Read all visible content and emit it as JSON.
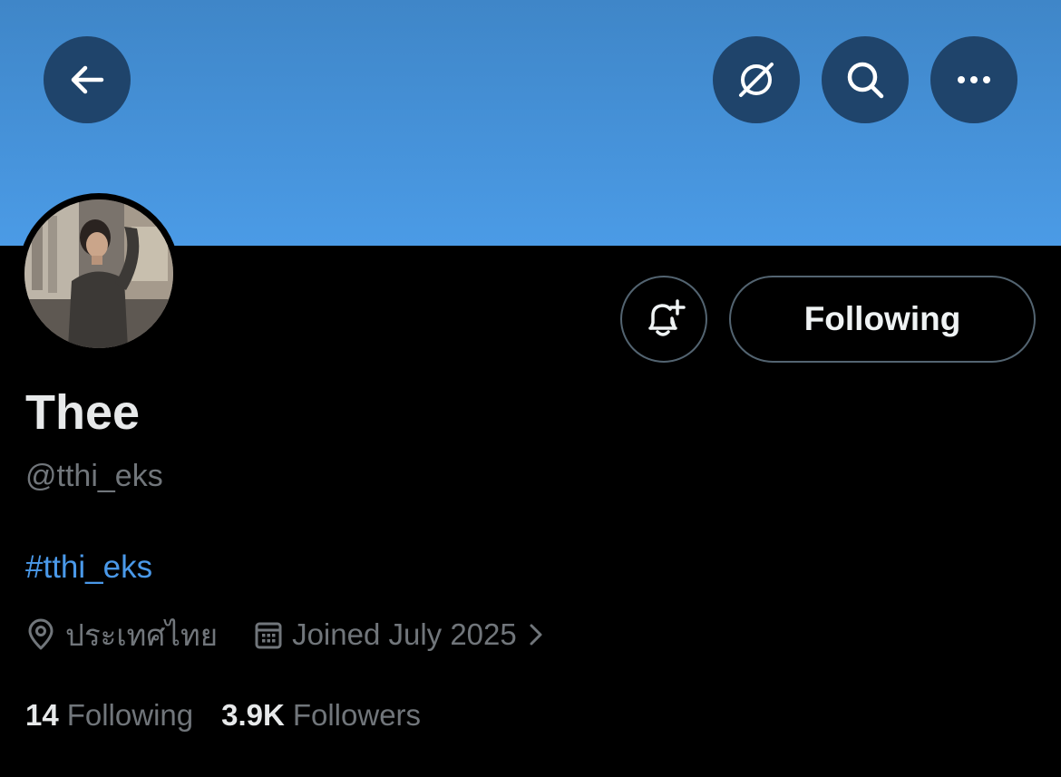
{
  "header": {
    "banner_color": "#4b9be6",
    "button_bg": "#1f446b",
    "icons": [
      "back-arrow-icon",
      "grok-icon",
      "search-icon",
      "more-icon"
    ]
  },
  "profile": {
    "display_name": "Thee",
    "handle": "@tthi_eks",
    "bio": "#tthi_eks",
    "location": "ประเทศไทย",
    "joined": "Joined July 2025"
  },
  "actions": {
    "following_label": "Following",
    "notify_icon": "bell-plus-icon"
  },
  "stats": {
    "following_count": "14",
    "following_label": "Following",
    "followers_count": "3.9K",
    "followers_label": "Followers"
  },
  "colors": {
    "link": "#4a99e9",
    "muted": "#71767b",
    "text": "#e7e9ea",
    "border": "#536471"
  }
}
